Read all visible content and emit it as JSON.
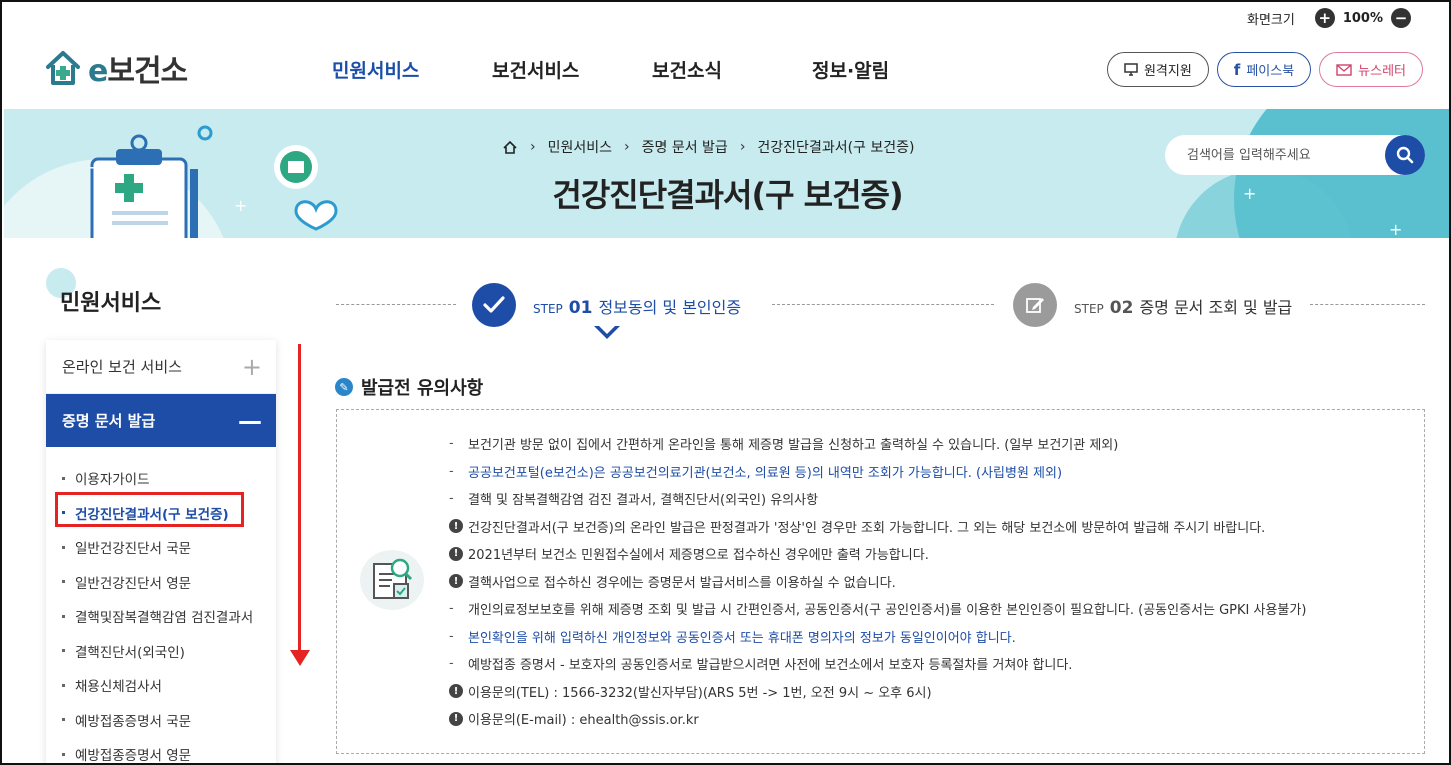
{
  "header": {
    "zoom_label": "화면크기",
    "zoom_value": "100%",
    "logo_e": "e",
    "logo_text": "보건소",
    "nav": [
      "민원서비스",
      "보건서비스",
      "보건소식",
      "정보·알림"
    ],
    "buttons": {
      "remote": "원격지원",
      "facebook": "페이스북",
      "newsletter": "뉴스레터"
    }
  },
  "banner": {
    "breadcrumb": [
      "민원서비스",
      "증명 문서 발급",
      "건강진단결과서(구 보건증)"
    ],
    "title": "건강진단결과서(구 보건증)",
    "search_placeholder": "검색어를 입력해주세요"
  },
  "sidebar": {
    "title": "민원서비스",
    "menu1": "온라인 보건 서비스",
    "menu2": "증명 문서 발급",
    "items": [
      "이용자가이드",
      "건강진단결과서(구 보건증)",
      "일반건강진단서 국문",
      "일반건강진단서 영문",
      "결핵및잠복결핵감염 검진결과서",
      "결핵진단서(외국인)",
      "채용신체검사서",
      "예방접종증명서 국문",
      "예방접종증명서 영문"
    ],
    "active_index": 1
  },
  "steps": {
    "step1_label": "STEP",
    "step1_num": "01",
    "step1_name": "정보동의 및 본인인증",
    "step2_label": "STEP",
    "step2_num": "02",
    "step2_name": "증명 문서 조회 및 발급"
  },
  "notice": {
    "title": "발급전 유의사항",
    "lines": [
      {
        "mark": "-",
        "style": "normal",
        "text": "보건기관 방문 없이 집에서 간편하게 온라인을 통해 제증명 발급을 신청하고 출력하실 수 있습니다. (일부 보건기관 제외)"
      },
      {
        "mark": "-",
        "style": "blue",
        "text": "공공보건포털(e보건소)은 공공보건의료기관(보건소, 의료원 등)의 내역만 조회가 가능합니다. (사립병원 제외)"
      },
      {
        "mark": "-",
        "style": "normal",
        "text": "결핵 및 잠복결핵감염 검진 결과서, 결핵진단서(외국인) 유의사항"
      },
      {
        "mark": "!",
        "style": "normal",
        "text": "건강진단결과서(구 보건증)의 온라인 발급은 판정결과가 '정상'인 경우만 조회 가능합니다. 그 외는 해당 보건소에 방문하여 발급해 주시기 바랍니다."
      },
      {
        "mark": "!",
        "style": "normal",
        "text": "2021년부터 보건소 민원접수실에서 제증명으로 접수하신 경우에만 출력 가능합니다."
      },
      {
        "mark": "!",
        "style": "normal",
        "text": "결핵사업으로 접수하신 경우에는 증명문서 발급서비스를 이용하실 수 없습니다."
      },
      {
        "mark": "-",
        "style": "normal",
        "text": "개인의료정보보호를 위해 제증명 조회 및 발급 시 간편인증서, 공동인증서(구 공인인증서)를 이용한 본인인증이 필요합니다. (공동인증서는 GPKI 사용불가)"
      },
      {
        "mark": "-",
        "style": "blue",
        "text": "본인확인을 위해 입력하신 개인정보와 공동인증서 또는 휴대폰 명의자의 정보가 동일인이어야 합니다."
      },
      {
        "mark": "-",
        "style": "normal",
        "text": "예방접종 증명서 - 보호자의 공동인증서로 발급받으시려면 사전에 보건소에서 보호자 등록절차를 거쳐야 합니다."
      },
      {
        "mark": "!",
        "style": "normal",
        "text": "이용문의(TEL) : 1566-3232(발신자부담)(ARS 5번 -> 1번, 오전 9시 ~ 오후 6시)"
      },
      {
        "mark": "!",
        "style": "normal",
        "text": "이용문의(E-mail) : ehealth@ssis.or.kr"
      }
    ]
  },
  "colors": {
    "primary": "#1d4da6",
    "banner_bg": "#c7ebee",
    "highlight": "#e52323"
  }
}
